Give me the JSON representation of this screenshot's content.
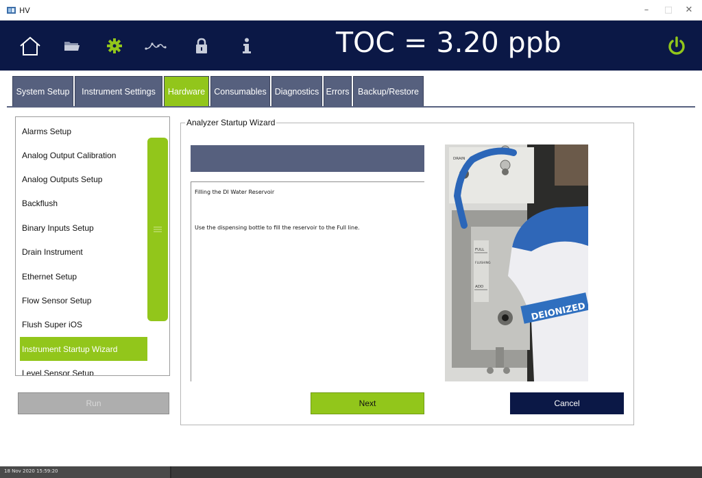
{
  "window": {
    "title": "HV",
    "minimize_glyph": "–",
    "maximize_glyph": "□",
    "close_glyph": "✕"
  },
  "header": {
    "reading": "TOC = 3.20 ppb",
    "icons": [
      "home-icon",
      "folder-icon",
      "gear-icon",
      "trend-icon",
      "lock-icon",
      "info-icon",
      "power-icon"
    ],
    "accent_color": "#92c61b",
    "background_color": "#0b1846"
  },
  "tabs": [
    {
      "label": "System Setup",
      "active": false
    },
    {
      "label": "Instrument Settings",
      "active": false
    },
    {
      "label": "Hardware",
      "active": true
    },
    {
      "label": "Consumables",
      "active": false
    },
    {
      "label": "Diagnostics",
      "active": false
    },
    {
      "label": "Errors",
      "active": false
    },
    {
      "label": "Backup/Restore",
      "active": false
    }
  ],
  "sidebar": {
    "items": [
      {
        "label": "Alarms Setup",
        "selected": false
      },
      {
        "label": "Analog Output Calibration",
        "selected": false
      },
      {
        "label": "Analog Outputs Setup",
        "selected": false
      },
      {
        "label": "Backflush",
        "selected": false
      },
      {
        "label": "Binary Inputs Setup",
        "selected": false
      },
      {
        "label": "Drain Instrument",
        "selected": false
      },
      {
        "label": "Ethernet Setup",
        "selected": false
      },
      {
        "label": "Flow Sensor Setup",
        "selected": false
      },
      {
        "label": "Flush Super iOS",
        "selected": false
      },
      {
        "label": "Instrument Startup Wizard",
        "selected": true
      },
      {
        "label": "Level Sensor Setup",
        "selected": false
      }
    ],
    "run_button_label": "Run"
  },
  "wizard": {
    "title": "Analyzer Startup Wizard",
    "step_title": "Filling the DI Water Reservoir",
    "instruction": "Use the dispensing bottle to fill the reservoir to the Full line.",
    "next_label": "Next",
    "cancel_label": "Cancel",
    "photo_labels": {
      "drain": "DRAIN",
      "full": "FULL",
      "flush_line": "FLUSHING BLOCK ONLY",
      "add": "ADD",
      "bottle_text": "DEIONIZED"
    }
  },
  "statusbar": {
    "timestamp": "18 Nov 2020 15:59:20"
  }
}
